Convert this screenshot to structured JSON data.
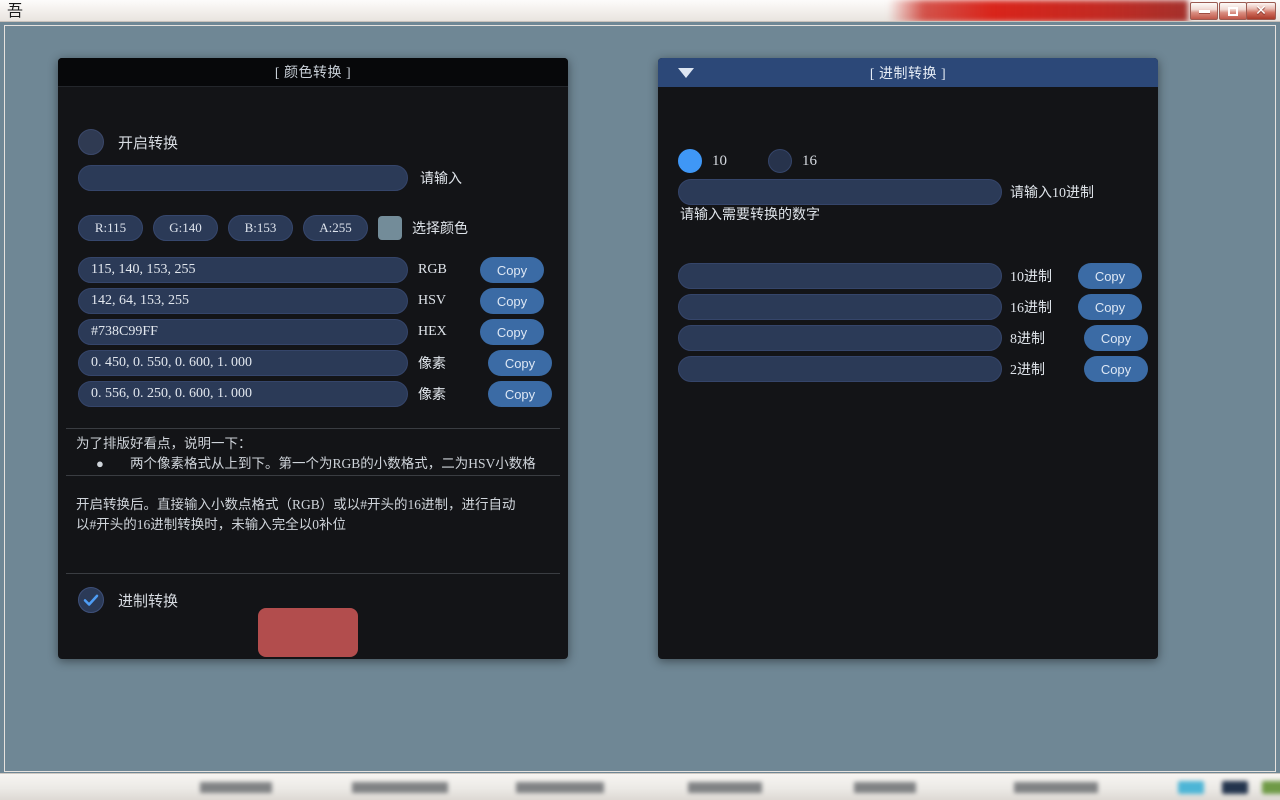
{
  "window": {
    "title_glyph": "吾",
    "blurred_title": "　　　",
    "minimize_label": "Minimize",
    "maximize_label": "Maximize",
    "close_label": "✕",
    "desktop_color": "#6f8795"
  },
  "color_panel": {
    "title": "[ 颜色转换 ]",
    "enable_toggle_label": "开启转换",
    "input": {
      "value": "",
      "placeholder": ""
    },
    "input_hint": "请输入",
    "channels": [
      {
        "name": "r-pill",
        "label": "R:115"
      },
      {
        "name": "g-pill",
        "label": "G:140"
      },
      {
        "name": "b-pill",
        "label": "B:153"
      },
      {
        "name": "a-pill",
        "label": "A:255"
      }
    ],
    "swatch_color": "#738c99",
    "pick_color_label": "选择颜色",
    "rows": [
      {
        "value": "115, 140, 153, 255",
        "label": "RGB",
        "copy": "Copy",
        "shift": 0
      },
      {
        "value": "142, 64, 153, 255",
        "label": "HSV",
        "copy": "Copy",
        "shift": 0
      },
      {
        "value": "#738C99FF",
        "label": "HEX",
        "copy": "Copy",
        "shift": 0
      },
      {
        "value": "0. 450, 0. 550, 0. 600, 1. 000",
        "label": "像素",
        "copy": "Copy",
        "shift": 8
      },
      {
        "value": "0. 556, 0. 250, 0. 600, 1. 000",
        "label": "像素",
        "copy": "Copy",
        "shift": 8
      }
    ],
    "notes": {
      "heading": "为了排版好看点，说明一下：",
      "bullet": "两个像素格式从上到下。第一个为RGB的小数格式，二为HSV小数格",
      "para1": "开启转换后。直接输入小数点格式（RGB）或以#开头的16进制，进行自动",
      "para2": "以#开头的16进制转换时，未输入完全以0补位"
    },
    "radix_checkbox_label": "进制转换",
    "red_button_label": "",
    "accent_blue": "#3b6ba5",
    "red_button_color": "#b24d4d"
  },
  "radix_panel": {
    "title": "[ 进制转换 ]",
    "collapse_icon": "chevron-down-icon",
    "radios": [
      {
        "label": "10",
        "selected": true
      },
      {
        "label": "16",
        "selected": false
      }
    ],
    "input": {
      "value": "",
      "placeholder": ""
    },
    "input_hint": "请输入10进制",
    "sub_hint": "请输入需要转换的数字",
    "rows": [
      {
        "value": "",
        "label": "10进制",
        "copy": "Copy",
        "shift": 0
      },
      {
        "value": "",
        "label": "16进制",
        "copy": "Copy",
        "shift": 0
      },
      {
        "value": "",
        "label": "8进制",
        "copy": "Copy",
        "shift": 6
      },
      {
        "value": "",
        "label": "2进制",
        "copy": "Copy",
        "shift": 6
      }
    ],
    "header_color": "#2c4878"
  }
}
